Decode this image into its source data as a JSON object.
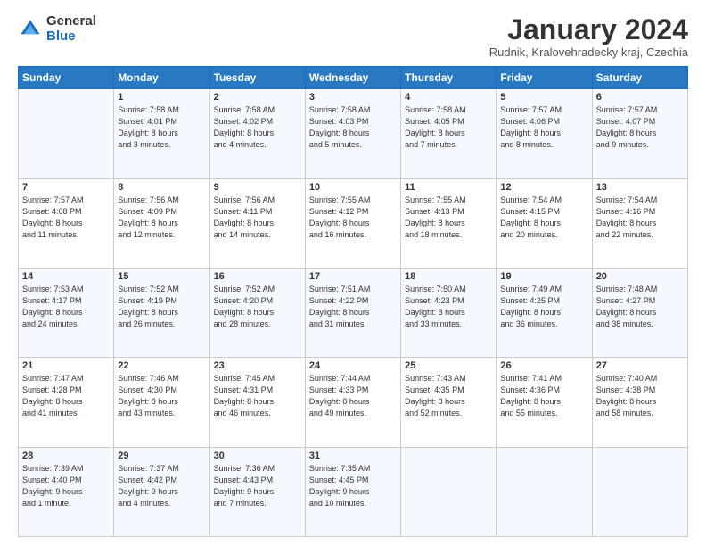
{
  "logo": {
    "general": "General",
    "blue": "Blue"
  },
  "header": {
    "month": "January 2024",
    "location": "Rudnik, Kralovehradecky kraj, Czechia"
  },
  "weekdays": [
    "Sunday",
    "Monday",
    "Tuesday",
    "Wednesday",
    "Thursday",
    "Friday",
    "Saturday"
  ],
  "weeks": [
    [
      {
        "day": "",
        "info": ""
      },
      {
        "day": "1",
        "info": "Sunrise: 7:58 AM\nSunset: 4:01 PM\nDaylight: 8 hours\nand 3 minutes."
      },
      {
        "day": "2",
        "info": "Sunrise: 7:58 AM\nSunset: 4:02 PM\nDaylight: 8 hours\nand 4 minutes."
      },
      {
        "day": "3",
        "info": "Sunrise: 7:58 AM\nSunset: 4:03 PM\nDaylight: 8 hours\nand 5 minutes."
      },
      {
        "day": "4",
        "info": "Sunrise: 7:58 AM\nSunset: 4:05 PM\nDaylight: 8 hours\nand 7 minutes."
      },
      {
        "day": "5",
        "info": "Sunrise: 7:57 AM\nSunset: 4:06 PM\nDaylight: 8 hours\nand 8 minutes."
      },
      {
        "day": "6",
        "info": "Sunrise: 7:57 AM\nSunset: 4:07 PM\nDaylight: 8 hours\nand 9 minutes."
      }
    ],
    [
      {
        "day": "7",
        "info": "Sunrise: 7:57 AM\nSunset: 4:08 PM\nDaylight: 8 hours\nand 11 minutes."
      },
      {
        "day": "8",
        "info": "Sunrise: 7:56 AM\nSunset: 4:09 PM\nDaylight: 8 hours\nand 12 minutes."
      },
      {
        "day": "9",
        "info": "Sunrise: 7:56 AM\nSunset: 4:11 PM\nDaylight: 8 hours\nand 14 minutes."
      },
      {
        "day": "10",
        "info": "Sunrise: 7:55 AM\nSunset: 4:12 PM\nDaylight: 8 hours\nand 16 minutes."
      },
      {
        "day": "11",
        "info": "Sunrise: 7:55 AM\nSunset: 4:13 PM\nDaylight: 8 hours\nand 18 minutes."
      },
      {
        "day": "12",
        "info": "Sunrise: 7:54 AM\nSunset: 4:15 PM\nDaylight: 8 hours\nand 20 minutes."
      },
      {
        "day": "13",
        "info": "Sunrise: 7:54 AM\nSunset: 4:16 PM\nDaylight: 8 hours\nand 22 minutes."
      }
    ],
    [
      {
        "day": "14",
        "info": "Sunrise: 7:53 AM\nSunset: 4:17 PM\nDaylight: 8 hours\nand 24 minutes."
      },
      {
        "day": "15",
        "info": "Sunrise: 7:52 AM\nSunset: 4:19 PM\nDaylight: 8 hours\nand 26 minutes."
      },
      {
        "day": "16",
        "info": "Sunrise: 7:52 AM\nSunset: 4:20 PM\nDaylight: 8 hours\nand 28 minutes."
      },
      {
        "day": "17",
        "info": "Sunrise: 7:51 AM\nSunset: 4:22 PM\nDaylight: 8 hours\nand 31 minutes."
      },
      {
        "day": "18",
        "info": "Sunrise: 7:50 AM\nSunset: 4:23 PM\nDaylight: 8 hours\nand 33 minutes."
      },
      {
        "day": "19",
        "info": "Sunrise: 7:49 AM\nSunset: 4:25 PM\nDaylight: 8 hours\nand 36 minutes."
      },
      {
        "day": "20",
        "info": "Sunrise: 7:48 AM\nSunset: 4:27 PM\nDaylight: 8 hours\nand 38 minutes."
      }
    ],
    [
      {
        "day": "21",
        "info": "Sunrise: 7:47 AM\nSunset: 4:28 PM\nDaylight: 8 hours\nand 41 minutes."
      },
      {
        "day": "22",
        "info": "Sunrise: 7:46 AM\nSunset: 4:30 PM\nDaylight: 8 hours\nand 43 minutes."
      },
      {
        "day": "23",
        "info": "Sunrise: 7:45 AM\nSunset: 4:31 PM\nDaylight: 8 hours\nand 46 minutes."
      },
      {
        "day": "24",
        "info": "Sunrise: 7:44 AM\nSunset: 4:33 PM\nDaylight: 8 hours\nand 49 minutes."
      },
      {
        "day": "25",
        "info": "Sunrise: 7:43 AM\nSunset: 4:35 PM\nDaylight: 8 hours\nand 52 minutes."
      },
      {
        "day": "26",
        "info": "Sunrise: 7:41 AM\nSunset: 4:36 PM\nDaylight: 8 hours\nand 55 minutes."
      },
      {
        "day": "27",
        "info": "Sunrise: 7:40 AM\nSunset: 4:38 PM\nDaylight: 8 hours\nand 58 minutes."
      }
    ],
    [
      {
        "day": "28",
        "info": "Sunrise: 7:39 AM\nSunset: 4:40 PM\nDaylight: 9 hours\nand 1 minute."
      },
      {
        "day": "29",
        "info": "Sunrise: 7:37 AM\nSunset: 4:42 PM\nDaylight: 9 hours\nand 4 minutes."
      },
      {
        "day": "30",
        "info": "Sunrise: 7:36 AM\nSunset: 4:43 PM\nDaylight: 9 hours\nand 7 minutes."
      },
      {
        "day": "31",
        "info": "Sunrise: 7:35 AM\nSunset: 4:45 PM\nDaylight: 9 hours\nand 10 minutes."
      },
      {
        "day": "",
        "info": ""
      },
      {
        "day": "",
        "info": ""
      },
      {
        "day": "",
        "info": ""
      }
    ]
  ]
}
